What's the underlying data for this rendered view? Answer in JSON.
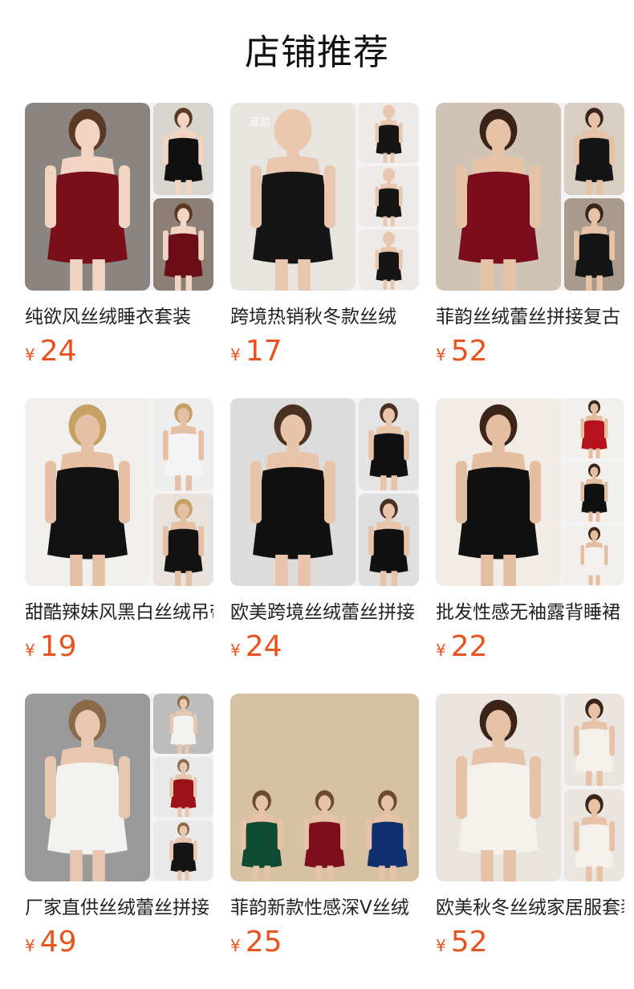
{
  "page": {
    "title": "店铺推荐"
  },
  "currency_symbol": "¥",
  "products": [
    {
      "title": "纯欲风丝绒睡衣套装",
      "price": "24",
      "layout": "side-2",
      "images": {
        "main": {
          "bg": "#8a8580",
          "garment": "#7a0f1a",
          "skin": "#f1d4c2",
          "hair": "#5a3a25"
        },
        "sides": [
          {
            "bg": "#d8d4ce",
            "garment": "#111111",
            "skin": "#f1d4c2",
            "hair": "#5a3a25"
          },
          {
            "bg": "#8b7f76",
            "garment": "#6b0d16",
            "skin": "#f1d4c2",
            "hair": "#5a3a25"
          }
        ]
      }
    },
    {
      "title": "跨境热销秋冬款丝绒",
      "price": "17",
      "layout": "side-3",
      "watermark": "菲韵",
      "images": {
        "main": {
          "bg": "#e8e4e0",
          "garment": "#151515",
          "skin": "#e9c7ae",
          "hair": "#e9c7ae"
        },
        "sides": [
          {
            "bg": "#ece9e6",
            "garment": "#151515",
            "skin": "#e9c7ae",
            "hair": "#e9c7ae"
          },
          {
            "bg": "#ece9e6",
            "garment": "#151515",
            "skin": "#e9c7ae",
            "hair": "#e9c7ae"
          },
          {
            "bg": "#ece9e6",
            "garment": "#151515",
            "skin": "#e9c7ae",
            "hair": "#e9c7ae"
          }
        ]
      }
    },
    {
      "title": "菲韵丝绒蕾丝拼接复古",
      "price": "52",
      "layout": "side-2",
      "images": {
        "main": {
          "bg": "#cfc3b5",
          "garment": "#7b0c1c",
          "skin": "#e6c2a6",
          "hair": "#3a2418"
        },
        "sides": [
          {
            "bg": "#d9cec2",
            "garment": "#141414",
            "skin": "#e6c2a6",
            "hair": "#3a2418"
          },
          {
            "bg": "#a89b8d",
            "garment": "#141414",
            "skin": "#e6c2a6",
            "hair": "#3a2418"
          }
        ]
      }
    },
    {
      "title": "甜酷辣妹风黑白丝绒吊带",
      "price": "19",
      "layout": "side-2",
      "images": {
        "main": {
          "bg": "#f2f0ed",
          "garment": "#121212",
          "skin": "#e6c0a4",
          "hair": "#c7a063"
        },
        "sides": [
          {
            "bg": "#eeeeee",
            "garment": "#f4f4f4",
            "skin": "#e6c0a4",
            "hair": "#c7a063"
          },
          {
            "bg": "#e7e2dc",
            "garment": "#121212",
            "skin": "#e6c0a4",
            "hair": "#c7a063"
          }
        ]
      }
    },
    {
      "title": "欧美跨境丝绒蕾丝拼接",
      "price": "24",
      "layout": "side-2",
      "images": {
        "main": {
          "bg": "#dcdcdc",
          "garment": "#111111",
          "skin": "#e8c4aa",
          "hair": "#4a3020"
        },
        "sides": [
          {
            "bg": "#e4e4e4",
            "garment": "#111111",
            "skin": "#e8c4aa",
            "hair": "#4a3020"
          },
          {
            "bg": "#dedede",
            "garment": "#111111",
            "skin": "#e8c4aa",
            "hair": "#4a3020"
          }
        ]
      }
    },
    {
      "title": "批发性感无袖露背睡裙",
      "price": "22",
      "layout": "side-3",
      "images": {
        "main": {
          "bg": "#f1ede6",
          "garment": "#111111",
          "skin": "#e4bea0",
          "hair": "#3b2518"
        },
        "sides": [
          {
            "bg": "#f2f0ec",
            "garment": "#b5121b",
            "skin": "#e4bea0",
            "hair": "#3b2518"
          },
          {
            "bg": "#f2f0ec",
            "garment": "#111111",
            "skin": "#e4bea0",
            "hair": "#3b2518"
          },
          {
            "bg": "#f2f0ec",
            "garment": "#f3f1ee",
            "skin": "#e4bea0",
            "hair": "#3b2518"
          }
        ]
      }
    },
    {
      "title": "厂家直供丝绒蕾丝拼接",
      "price": "49",
      "layout": "side-3",
      "images": {
        "main": {
          "bg": "#9a9a9a",
          "garment": "#f2f2f0",
          "skin": "#e8c7b0",
          "hair": "#8a6a48"
        },
        "sides": [
          {
            "bg": "#bdbdbd",
            "garment": "#f2f2f0",
            "skin": "#e8c7b0",
            "hair": "#8a6a48"
          },
          {
            "bg": "#e9e9e9",
            "garment": "#9a1119",
            "skin": "#e8c7b0",
            "hair": "#8a6a48"
          },
          {
            "bg": "#e9e9e9",
            "garment": "#141414",
            "skin": "#e8c7b0",
            "hair": "#8a6a48"
          }
        ]
      }
    },
    {
      "title": "菲韵新款性感深V丝绒",
      "price": "25",
      "layout": "triple",
      "images": {
        "main": {
          "bg": "#d6c2a2",
          "garment": "#0f5a3a",
          "skin": "#e6c3a8",
          "hair": "#6a4a30"
        },
        "models": [
          {
            "garment": "#0f4a32"
          },
          {
            "garment": "#7d0f1c"
          },
          {
            "garment": "#0f2f6e"
          }
        ]
      }
    },
    {
      "title": "欧美秋冬丝绒家居服套装",
      "price": "52",
      "layout": "side-2",
      "images": {
        "main": {
          "bg": "#e9e4dd",
          "garment": "#f4f1ec",
          "skin": "#e6c3a8",
          "hair": "#3a2418"
        },
        "sides": [
          {
            "bg": "#eae5de",
            "garment": "#f4f1ec",
            "skin": "#e6c3a8",
            "hair": "#3a2418"
          },
          {
            "bg": "#eae5de",
            "garment": "#f4f1ec",
            "skin": "#e6c3a8",
            "hair": "#3a2418"
          }
        ]
      }
    }
  ],
  "colors": {
    "price": "#e8541e",
    "title_text": "#222222"
  }
}
